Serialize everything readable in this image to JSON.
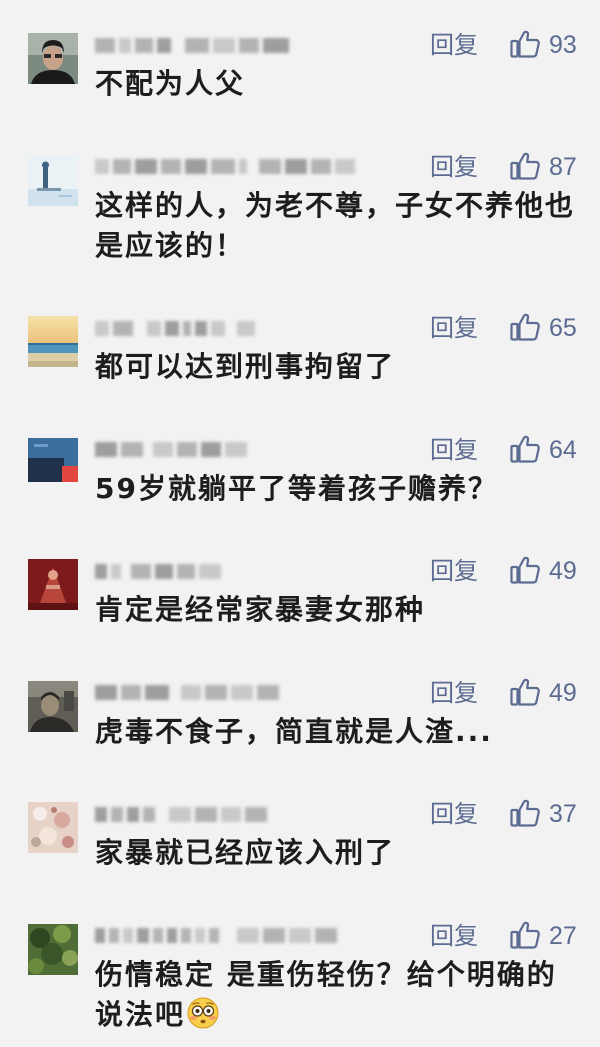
{
  "colors": {
    "background": "#f2f2f2",
    "accent": "#5b6b91",
    "text": "#1d1d1d",
    "username_blur": "#a8a8a8"
  },
  "icons": {
    "like": "thumbs-up-outline-icon"
  },
  "labels": {
    "reply": "回复"
  },
  "comments": [
    {
      "likes": 93,
      "lines": [
        "不配为人父"
      ]
    },
    {
      "likes": 87,
      "lines": [
        "这样的人，为老不尊，子女不养他也",
        "是应该的！"
      ]
    },
    {
      "likes": 65,
      "lines": [
        "都可以达到刑事拘留了"
      ]
    },
    {
      "likes": 64,
      "lines": [
        "59岁就躺平了等着孩子赡养？"
      ]
    },
    {
      "likes": 49,
      "lines": [
        "肯定是经常家暴妻女那种"
      ]
    },
    {
      "likes": 49,
      "lines": [
        "虎毒不食子，简直就是人渣..."
      ]
    },
    {
      "likes": 37,
      "lines": [
        "家暴就已经应该入刑了"
      ]
    },
    {
      "likes": 27,
      "lines": [
        "伤情稳定 是重伤轻伤？给个明确的",
        "说法吧"
      ],
      "emoji": "flushed-face"
    }
  ]
}
